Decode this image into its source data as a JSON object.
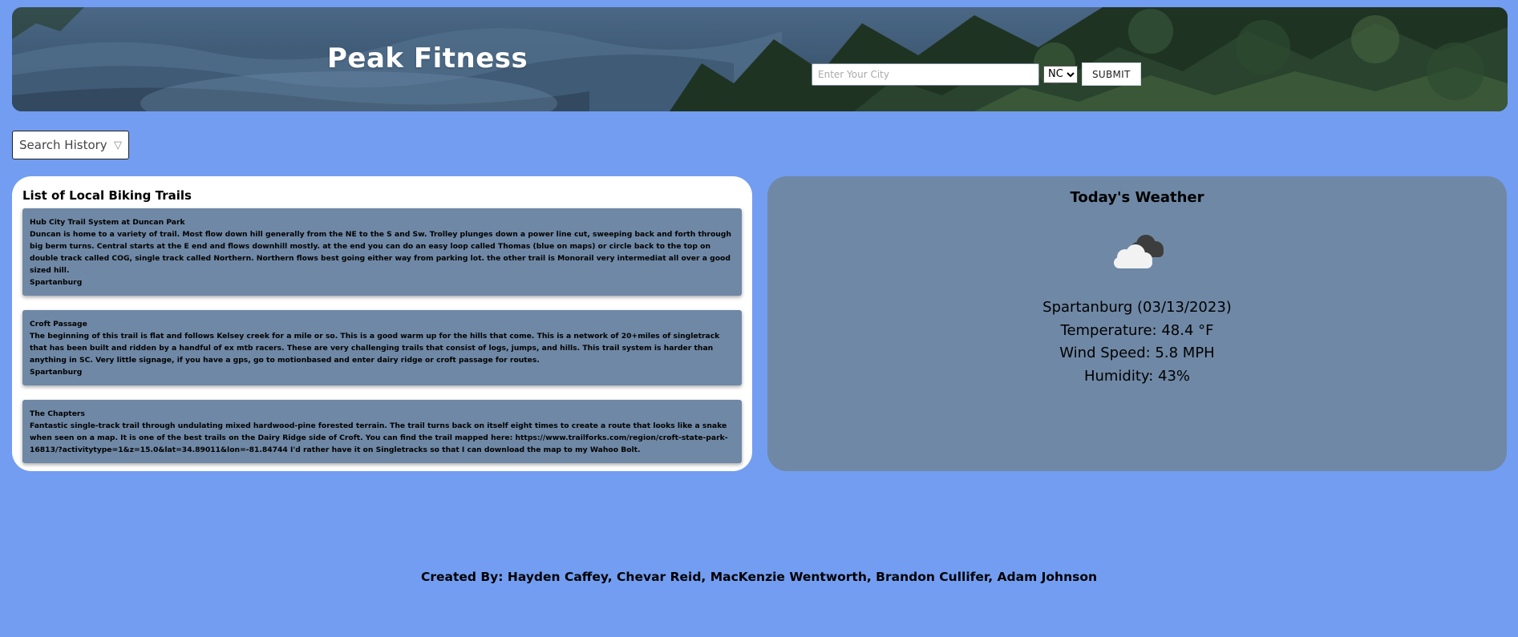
{
  "header": {
    "title": "Peak Fitness",
    "city_placeholder": "Enter Your City",
    "city_value": "",
    "state_selected": "NC",
    "state_options": [
      "NC"
    ],
    "submit_label": "SUBMIT"
  },
  "history": {
    "label": "Search History",
    "arrow_icon": "triangle-down-icon"
  },
  "trails": {
    "heading": "List of Local Biking Trails",
    "items": [
      {
        "name": "Hub City Trail System at Duncan Park",
        "description": "Duncan is home to a variety of trail. Most flow down hill generally from the NE to the S and Sw. Trolley plunges down a power line cut, sweeping back and forth through big berm turns. Central starts at the E end and flows downhill mostly. at the end you can do an easy loop called Thomas (blue on maps) or circle back to the top on double track called COG, single track called Northern. Northern flows best going either way from parking lot. the other trail is Monorail very intermediat all over a good sized hill.",
        "location": "Spartanburg"
      },
      {
        "name": "Croft Passage",
        "description": "The beginning of this trail is flat and follows Kelsey creek for a mile or so. This is a good warm up for the hills that come. This is a network of 20+miles of singletrack that has been built and ridden by a handful of ex mtb racers. These are very challenging trails that consist of logs, jumps, and hills. This trail system is harder than anything in SC. Very little signage, if you have a gps, go to motionbased and enter dairy ridge or croft passage for routes.",
        "location": "Spartanburg"
      },
      {
        "name": "The Chapters",
        "description": "Fantastic single-track trail through undulating mixed hardwood-pine forested terrain.  The trail turns back on itself eight times to create a route that looks like a snake when seen on a map.  It is one of the best trails on the Dairy Ridge side of Croft.  You can find the trail mapped here: https://www.trailforks.com/region/croft-state-park-16813/?activitytype=1&z=15.0&lat=34.89011&lon=-81.84744 I'd rather have it on Singletracks so that I can download the map to my Wahoo Bolt.",
        "location": ""
      }
    ]
  },
  "weather": {
    "title": "Today's Weather",
    "icon": "cloudy-icon",
    "city_date": "Spartanburg (03/13/2023)",
    "temperature": "Temperature: 48.4 °F",
    "wind": "Wind Speed: 5.8 MPH",
    "humidity": "Humidity: 43%"
  },
  "footer": {
    "credits": "Created By: Hayden Caffey, Chevar Reid, MacKenzie Wentworth, Brandon Cullifer, Adam Johnson"
  },
  "colors": {
    "page_background": "#729df1",
    "panel_slate": "#6f88a5",
    "card_white": "#ffffff"
  }
}
